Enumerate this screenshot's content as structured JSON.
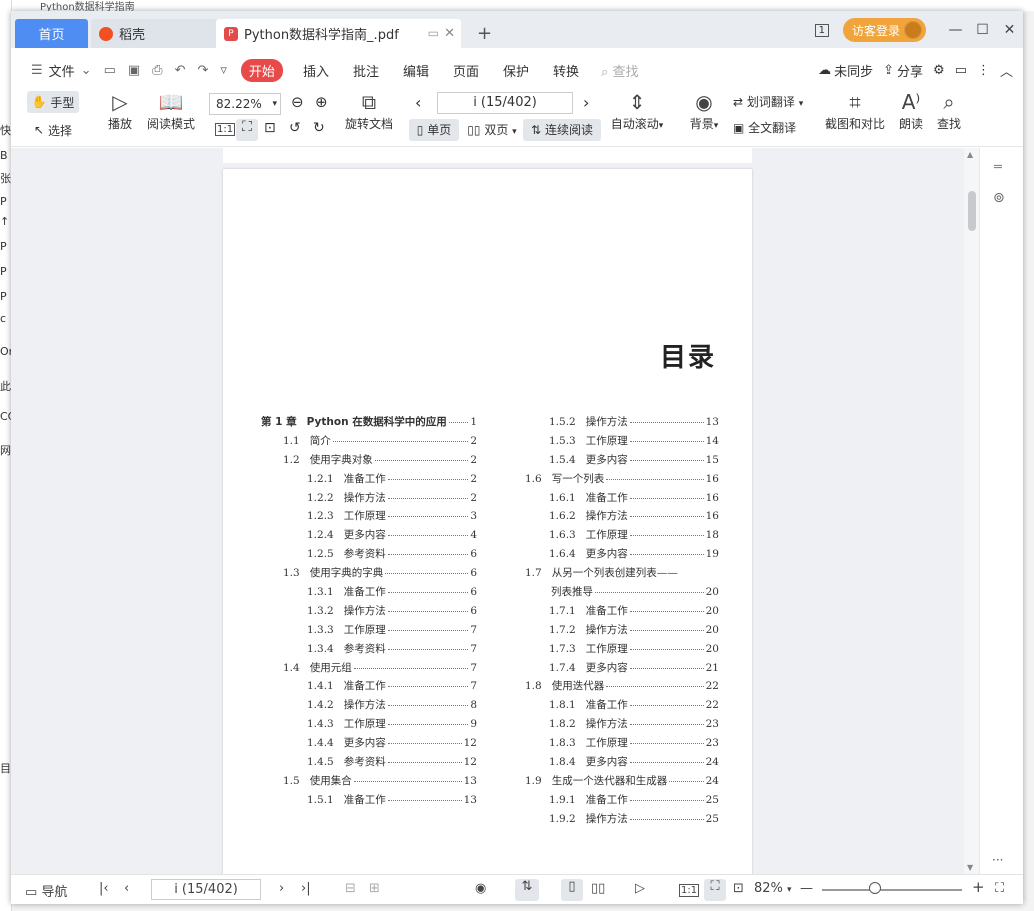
{
  "background": {
    "topbar_text": "Python数据科学指南",
    "left_chars": [
      "快",
      "B",
      "张",
      "P",
      "↑",
      "P",
      "P",
      "P",
      "c",
      "Or",
      "此",
      "CC",
      "网",
      "目"
    ]
  },
  "titlebar": {
    "tabs": [
      {
        "label": "首页"
      },
      {
        "label": "稻壳"
      },
      {
        "label": "Python数据科学指南_.pdf"
      }
    ],
    "add_tab": "+",
    "badge": "1",
    "guest_login": "访客登录",
    "window_controls": [
      "—",
      "☐",
      "✕"
    ]
  },
  "menu": {
    "file": "文件",
    "tabs": [
      "开始",
      "插入",
      "批注",
      "编辑",
      "页面",
      "保护",
      "转换"
    ],
    "search": "查找",
    "unsynced": "未同步",
    "share": "分享"
  },
  "toolbar": {
    "hand": "手型",
    "select": "选择",
    "play": "播放",
    "read_mode": "阅读模式",
    "zoom": "82.22%",
    "rotate": "旋转文档",
    "page_input": "i (15/402)",
    "single": "单页",
    "double": "双页",
    "continuous": "连续阅读",
    "auto_scroll": "自动滚动",
    "background": "背景",
    "word_translate": "划词翻译",
    "full_translate": "全文翻译",
    "screenshot_compare": "截图和对比",
    "read_aloud": "朗读",
    "find": "查找"
  },
  "document": {
    "toc_title": "目录",
    "left_column": [
      {
        "num": "第 1 章",
        "text": "Python 在数据科学中的应用",
        "page": "1",
        "level": 0
      },
      {
        "num": "1.1",
        "text": "简介",
        "page": "2",
        "level": 1
      },
      {
        "num": "1.2",
        "text": "使用字典对象",
        "page": "2",
        "level": 1
      },
      {
        "num": "1.2.1",
        "text": "准备工作",
        "page": "2",
        "level": 2
      },
      {
        "num": "1.2.2",
        "text": "操作方法",
        "page": "2",
        "level": 2
      },
      {
        "num": "1.2.3",
        "text": "工作原理",
        "page": "3",
        "level": 2
      },
      {
        "num": "1.2.4",
        "text": "更多内容",
        "page": "4",
        "level": 2
      },
      {
        "num": "1.2.5",
        "text": "参考资料",
        "page": "6",
        "level": 2
      },
      {
        "num": "1.3",
        "text": "使用字典的字典",
        "page": "6",
        "level": 1
      },
      {
        "num": "1.3.1",
        "text": "准备工作",
        "page": "6",
        "level": 2
      },
      {
        "num": "1.3.2",
        "text": "操作方法",
        "page": "6",
        "level": 2
      },
      {
        "num": "1.3.3",
        "text": "工作原理",
        "page": "7",
        "level": 2
      },
      {
        "num": "1.3.4",
        "text": "参考资料",
        "page": "7",
        "level": 2
      },
      {
        "num": "1.4",
        "text": "使用元组",
        "page": "7",
        "level": 1
      },
      {
        "num": "1.4.1",
        "text": "准备工作",
        "page": "7",
        "level": 2
      },
      {
        "num": "1.4.2",
        "text": "操作方法",
        "page": "8",
        "level": 2
      },
      {
        "num": "1.4.3",
        "text": "工作原理",
        "page": "9",
        "level": 2
      },
      {
        "num": "1.4.4",
        "text": "更多内容",
        "page": "12",
        "level": 2
      },
      {
        "num": "1.4.5",
        "text": "参考资料",
        "page": "12",
        "level": 2
      },
      {
        "num": "1.5",
        "text": "使用集合",
        "page": "13",
        "level": 1
      },
      {
        "num": "1.5.1",
        "text": "准备工作",
        "page": "13",
        "level": 2
      }
    ],
    "right_column": [
      {
        "num": "1.5.2",
        "text": "操作方法",
        "page": "13",
        "level": 2
      },
      {
        "num": "1.5.3",
        "text": "工作原理",
        "page": "14",
        "level": 2
      },
      {
        "num": "1.5.4",
        "text": "更多内容",
        "page": "15",
        "level": 2
      },
      {
        "num": "1.6",
        "text": "写一个列表",
        "page": "16",
        "level": 1
      },
      {
        "num": "1.6.1",
        "text": "准备工作",
        "page": "16",
        "level": 2
      },
      {
        "num": "1.6.2",
        "text": "操作方法",
        "page": "16",
        "level": 2
      },
      {
        "num": "1.6.3",
        "text": "工作原理",
        "page": "18",
        "level": 2
      },
      {
        "num": "1.6.4",
        "text": "更多内容",
        "page": "19",
        "level": 2
      },
      {
        "num": "1.7",
        "text": "从另一个列表创建列表——",
        "page": "",
        "level": 1
      },
      {
        "num": "",
        "text": "列表推导",
        "page": "20",
        "level": 1
      },
      {
        "num": "1.7.1",
        "text": "准备工作",
        "page": "20",
        "level": 2
      },
      {
        "num": "1.7.2",
        "text": "操作方法",
        "page": "20",
        "level": 2
      },
      {
        "num": "1.7.3",
        "text": "工作原理",
        "page": "20",
        "level": 2
      },
      {
        "num": "1.7.4",
        "text": "更多内容",
        "page": "21",
        "level": 2
      },
      {
        "num": "1.8",
        "text": "使用迭代器",
        "page": "22",
        "level": 1
      },
      {
        "num": "1.8.1",
        "text": "准备工作",
        "page": "22",
        "level": 2
      },
      {
        "num": "1.8.2",
        "text": "操作方法",
        "page": "23",
        "level": 2
      },
      {
        "num": "1.8.3",
        "text": "工作原理",
        "page": "23",
        "level": 2
      },
      {
        "num": "1.8.4",
        "text": "更多内容",
        "page": "24",
        "level": 2
      },
      {
        "num": "1.9",
        "text": "生成一个迭代器和生成器",
        "page": "24",
        "level": 1
      },
      {
        "num": "1.9.1",
        "text": "准备工作",
        "page": "25",
        "level": 2
      },
      {
        "num": "1.9.2",
        "text": "操作方法",
        "page": "25",
        "level": 2
      }
    ]
  },
  "statusbar": {
    "nav": "导航",
    "page": "i (15/402)",
    "zoom": "82%",
    "zoom_fraction": 0.38
  },
  "sidebar": {
    "more": "···"
  },
  "colors": {
    "accent_blue": "#4f8df2",
    "start_red": "#e84a4a",
    "guest_orange": "#f0a43b"
  }
}
